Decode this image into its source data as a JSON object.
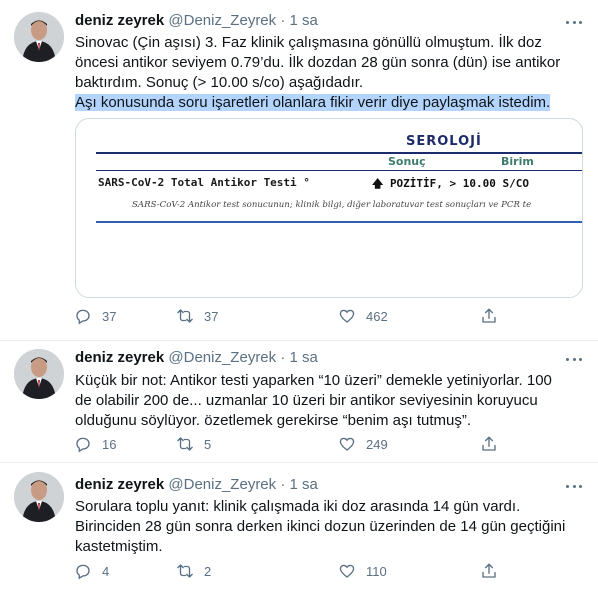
{
  "tweets": [
    {
      "name": "deniz zeyrek",
      "handle": "@Deniz_Zeyrek",
      "dot": "·",
      "time": "1 sa",
      "text_lines": [
        "Sinovac (Çin aşısı) 3. Faz klinik çalışmasına gönüllü olmuştum. İlk doz",
        "öncesi antikor seviyem 0.79’du. İlk dozdan 28 gün sonra (dün) ise antikor",
        "baktırdım. Sonuç (> 10.00 s/co) aşağıdadır."
      ],
      "highlight_line": "Aşı konusunda soru işaretleri olanlara fikir verir diye paylaşmak istedim.",
      "stats": {
        "replies": "37",
        "retweets": "37",
        "likes": "462"
      }
    },
    {
      "name": "deniz zeyrek",
      "handle": "@Deniz_Zeyrek",
      "dot": "·",
      "time": "1 sa",
      "text_lines": [
        "Küçük bir not: Antikor testi yaparken “10 üzeri” demekle yetiniyorlar. 100",
        "de olabilir 200 de... uzmanlar 10 üzeri bir antikor seviyesinin koruyucu",
        "olduğunu söylüyor. özetlemek gerekirse “benim aşı tutmuş”."
      ],
      "stats": {
        "replies": "16",
        "retweets": "5",
        "likes": "249"
      }
    },
    {
      "name": "deniz zeyrek",
      "handle": "@Deniz_Zeyrek",
      "dot": "·",
      "time": "1 sa",
      "text_lines": [
        "Sorulara toplu yanıt: klinik çalışmada iki doz arasında 14 gün vardı.",
        "Birinciden 28 gün sonra derken ikinci dozun üzerinden de 14 gün geçtiğini",
        "kastetmiştim."
      ],
      "stats": {
        "replies": "4",
        "retweets": "2",
        "likes": "110"
      }
    }
  ],
  "lab_card": {
    "section": "SEROLOJİ",
    "col_result": "Sonuç",
    "col_unit": "Birim",
    "test_name": "SARS-CoV-2 Total Antikor Testi °",
    "result": "POZİTİF, > 10.00 S/CO",
    "note": "SARS-CoV-2 Antikor test sonucunun; klinik bilgi, diğer laboratuvar test sonuçları ve PCR te"
  },
  "icons": [
    "reply-icon",
    "retweet-icon",
    "like-icon",
    "share-icon",
    "more-icon"
  ],
  "colors": {
    "muted": "#5b7083",
    "highlight": "#b3d4fc",
    "lab_navy": "#1c2b6b",
    "lab_green": "#3e7d6e"
  }
}
